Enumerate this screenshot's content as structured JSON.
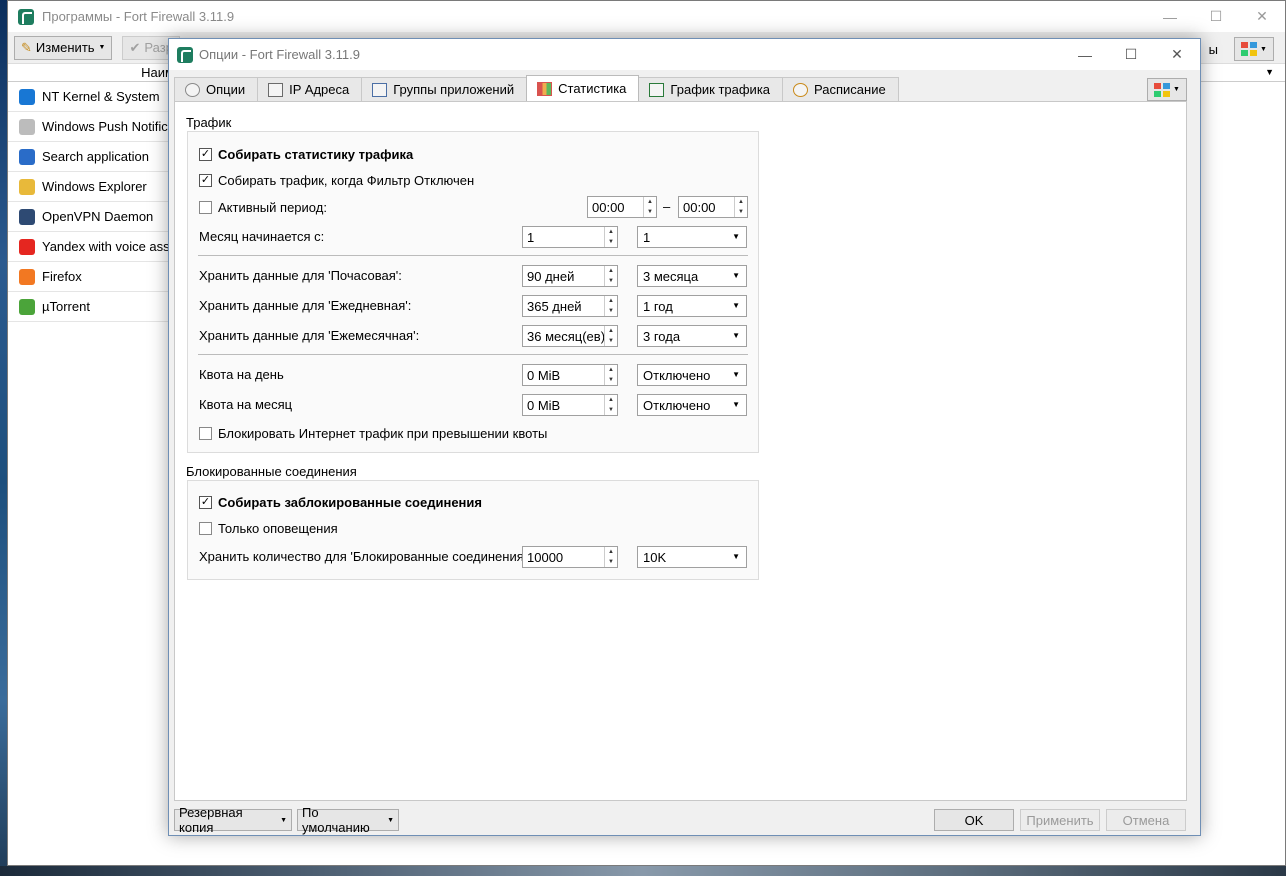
{
  "main_window": {
    "title": "Программы - Fort Firewall 3.11.9",
    "edit_button": "Изменить",
    "allow_button": "Разр",
    "right_text": "ы",
    "column_header": "Наим",
    "apps": [
      {
        "name": "NT Kernel & System",
        "color": "#1877d4"
      },
      {
        "name": "Windows Push Notificat",
        "color": "#bcbcbc"
      },
      {
        "name": "Search application",
        "color": "#2a6cc8"
      },
      {
        "name": "Windows Explorer",
        "color": "#e8b93a"
      },
      {
        "name": "OpenVPN Daemon",
        "color": "#2e4a73"
      },
      {
        "name": "Yandex with voice assis",
        "color": "#e52620"
      },
      {
        "name": "Firefox",
        "color": "#f27822"
      },
      {
        "name": "µTorrent",
        "color": "#4ba43a"
      }
    ]
  },
  "dialog": {
    "title": "Опции - Fort Firewall 3.11.9",
    "tabs": [
      {
        "label": "Опции",
        "icon": "gear-icon"
      },
      {
        "label": "IP Адреса",
        "icon": "ip-address-icon"
      },
      {
        "label": "Группы приложений",
        "icon": "app-groups-icon"
      },
      {
        "label": "Статистика",
        "icon": "statistics-icon"
      },
      {
        "label": "График трафика",
        "icon": "traffic-graph-icon"
      },
      {
        "label": "Расписание",
        "icon": "clock-icon"
      }
    ],
    "active_tab": "Статистика",
    "traffic": {
      "title": "Трафик",
      "collect_stats": {
        "label": "Собирать статистику трафика",
        "checked": true
      },
      "collect_when_off": {
        "label": "Собирать трафик, когда Фильтр Отключен",
        "checked": true
      },
      "active_period": {
        "label": "Активный период:",
        "checked": false,
        "from": "00:00",
        "to": "00:00",
        "dash": "–"
      },
      "month_start": {
        "label": "Месяц начинается с:",
        "value": "1",
        "combo": "1"
      },
      "keep_hourly": {
        "label": "Хранить данные для 'Почасовая':",
        "value": "90 дней",
        "combo": "3 месяца"
      },
      "keep_daily": {
        "label": "Хранить данные для 'Ежедневная':",
        "value": "365 дней",
        "combo": "1 год"
      },
      "keep_monthly": {
        "label": "Хранить данные для 'Ежемесячная':",
        "value": "36 месяц(ев)",
        "combo": "3 года"
      },
      "quota_day": {
        "label": "Квота на день",
        "value": "0 MiB",
        "combo": "Отключено"
      },
      "quota_month": {
        "label": "Квота на месяц",
        "value": "0 MiB",
        "combo": "Отключено"
      },
      "block_on_quota": {
        "label": "Блокировать Интернет трафик при превышении квоты",
        "checked": false
      }
    },
    "blocked": {
      "title": "Блокированные соединения",
      "collect_blocked": {
        "label": "Собирать заблокированные соединения",
        "checked": true
      },
      "alerts_only": {
        "label": "Только оповещения",
        "checked": false
      },
      "keep_count": {
        "label": "Хранить количество для 'Блокированные соединения':",
        "value": "10000",
        "combo": "10K"
      }
    },
    "buttons": {
      "backup": "Резервная копия",
      "defaults": "По умолчанию",
      "ok": "OK",
      "apply": "Применить",
      "cancel": "Отмена"
    }
  }
}
